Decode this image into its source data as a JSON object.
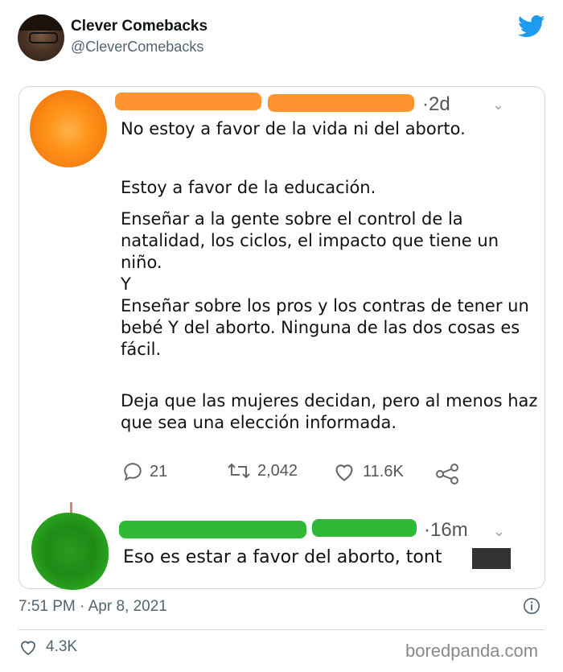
{
  "author": {
    "display_name": "Clever Comebacks",
    "handle": "@CleverComebacks"
  },
  "embedded_screenshot": {
    "comment": {
      "time": "·2d",
      "paragraphs": [
        "No estoy a favor de la vida ni del aborto.",
        "Estoy a favor de la educación.",
        "Enseñar a la gente sobre el control de la natalidad, los ciclos, el impacto que tiene un niño.\nY\nEnseñar sobre los pros y los contras de tener un bebé Y del aborto. Ninguna de las dos cosas es fácil.",
        "Deja que las mujeres decidan, pero al menos haz que sea una elección informada."
      ],
      "actions": {
        "replies": "21",
        "retweets": "2,042",
        "likes": "11.6K"
      },
      "avatar_color": "#ff951c"
    },
    "reply": {
      "time": "·16m",
      "text": "Eso es estar a favor del aborto, tont",
      "avatar_color": "#1f8a16"
    }
  },
  "tweet": {
    "timestamp": "7:51 PM · Apr 8, 2021",
    "likes": "4.3K"
  },
  "watermark": "boredpanda.com",
  "colors": {
    "twitter_blue": "#1d9bf0",
    "secondary_text": "#536471"
  }
}
